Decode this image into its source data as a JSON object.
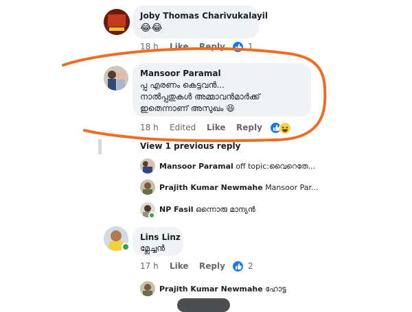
{
  "comments": [
    {
      "author": "Joby Thomas Charivukalayil",
      "lines": [
        "😂😂"
      ],
      "time": "18 h",
      "like": "Like",
      "reply": "Reply",
      "count": "1"
    },
    {
      "author": "Mansoor Paramal",
      "lines": [
        "പ്പ എരണം കെട്ടവൻ...",
        "നാൽപ്പതുകൾ അമ്മാവൻമാർക്ക്",
        "ഇതെന്നാണ് അസുഖം 😆"
      ],
      "time": "18 h",
      "edited": "Edited",
      "like": "Like",
      "reply": "Reply"
    },
    {
      "author": "Lins Linz",
      "lines": [
        "മ്ലേച്ചൻ"
      ],
      "time": "17 h",
      "like": "Like",
      "reply": "Reply",
      "count": "2"
    }
  ],
  "view_previous": "View 1 previous reply",
  "replies": [
    {
      "author": "Mansoor Paramal",
      "text": "off topic:വൈറെതേ..."
    },
    {
      "author": "Prajith Kumar Newmahe",
      "text": "Mansoor Par..."
    },
    {
      "author": "NP Fasil",
      "text": "ഒന്നൊരു മാന്യൻ"
    }
  ],
  "reply_last": {
    "author": "Prajith Kumar Newmahe",
    "text": "ഹോട്ട"
  },
  "colors": {
    "accent": "#1877f2",
    "annotation": "#f26b21",
    "bubble": "#f0f2f5",
    "muted": "#65676b"
  }
}
